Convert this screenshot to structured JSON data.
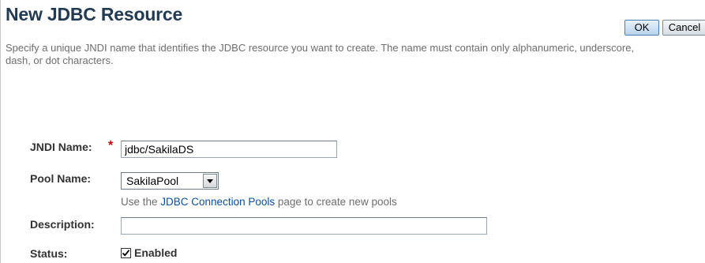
{
  "header": {
    "title": "New JDBC Resource",
    "ok_label": "OK",
    "cancel_label": "Cancel"
  },
  "help_text": "Specify a unique JNDI name that identifies the JDBC resource you want to create. The name must contain only alphanumeric, underscore, dash, or dot characters.",
  "form": {
    "jndi_name": {
      "label": "JNDI Name:",
      "required_marker": "*",
      "value": "jdbc/SakilaDS"
    },
    "pool_name": {
      "label": "Pool Name:",
      "selected": "SakilaPool",
      "hint_prefix": "Use the ",
      "hint_link": "JDBC Connection Pools",
      "hint_suffix": " page to create new pools"
    },
    "description": {
      "label": "Description:",
      "value": ""
    },
    "status": {
      "label": "Status:",
      "checkbox_label": "Enabled",
      "checked": true
    }
  },
  "colors": {
    "title": "#223a52",
    "required": "#cc0000",
    "link": "#0a4f9e",
    "help_text": "#6e6e6e"
  }
}
